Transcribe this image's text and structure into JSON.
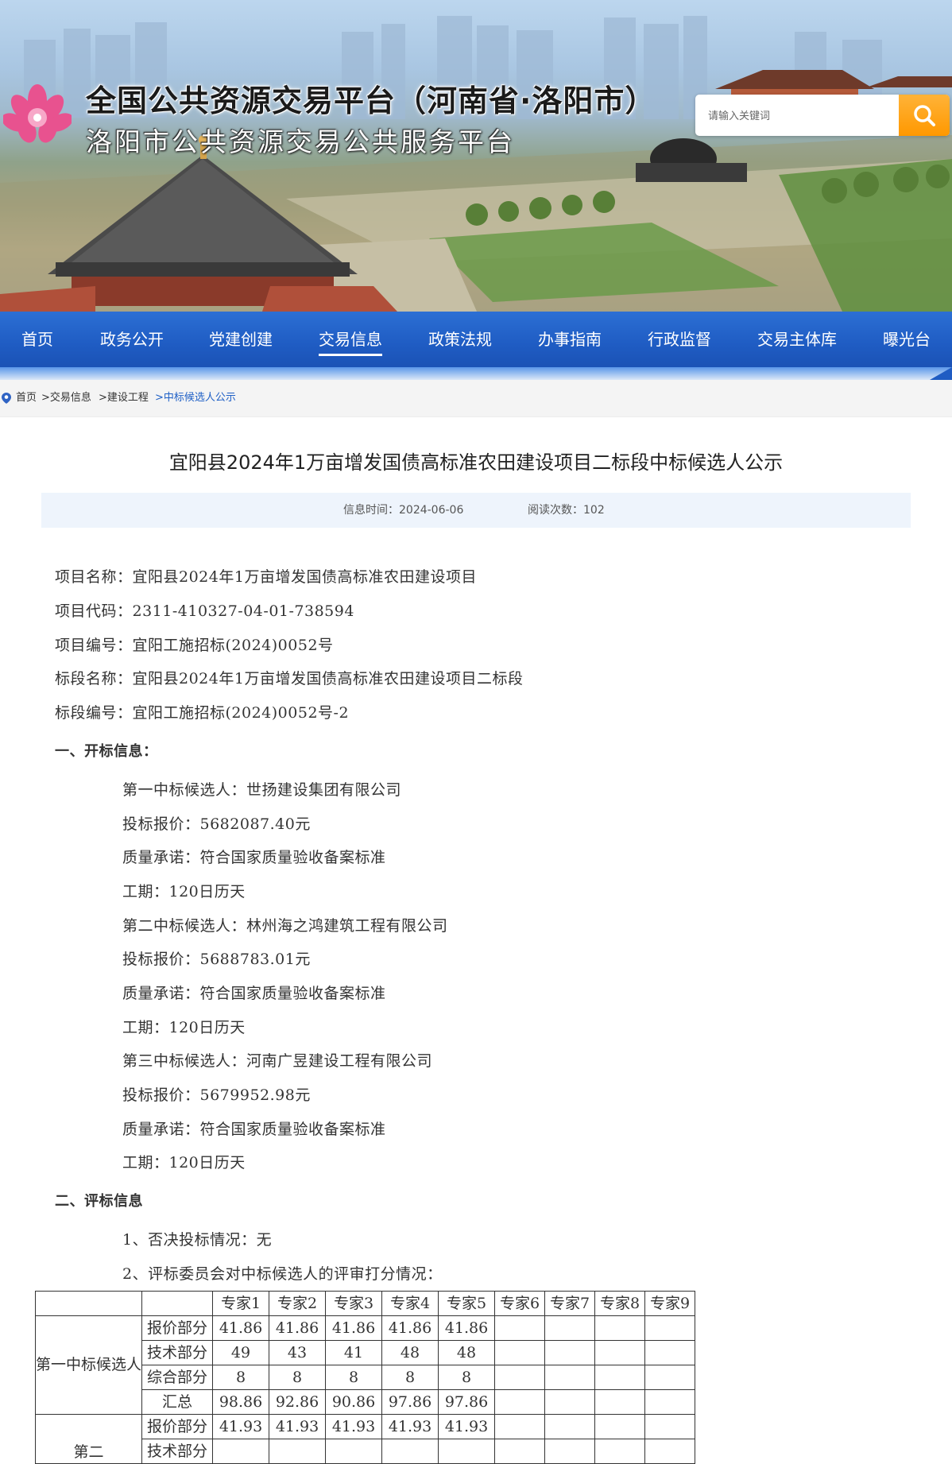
{
  "header": {
    "title": "全国公共资源交易平台（河南省·洛阳市）",
    "subtitle": "洛阳市公共资源交易公共服务平台",
    "search_placeholder": "请输入关键词"
  },
  "nav": {
    "items": [
      "首页",
      "政务公开",
      "党建创建",
      "交易信息",
      "政策法规",
      "办事指南",
      "行政监督",
      "交易主体库",
      "曝光台"
    ],
    "active": "交易信息"
  },
  "breadcrumb": {
    "items": [
      "首页",
      ">交易信息",
      ">建设工程",
      ">中标候选人公示"
    ]
  },
  "article": {
    "title": "宜阳县2024年1万亩增发国债高标准农田建设项目二标段中标候选人公示",
    "info_time": "信息时间：2024-06-06",
    "read_count": "阅读次数：102",
    "project_lines": [
      "项目名称：宜阳县2024年1万亩增发国债高标准农田建设项目",
      "项目代码：2311-410327-04-01-738594",
      "项目编号：宜阳工施招标(2024)0052号",
      "标段名称：宜阳县2024年1万亩增发国债高标准农田建设项目二标段",
      "标段编号：宜阳工施招标(2024)0052号-2"
    ],
    "section1": "一、开标信息：",
    "candidates": [
      "第一中标候选人：世扬建设集团有限公司",
      "投标报价：5682087.40元",
      "质量承诺：符合国家质量验收备案标准",
      "工期：120日历天",
      "第二中标候选人：林州海之鸿建筑工程有限公司",
      "投标报价：5688783.01元",
      "质量承诺：符合国家质量验收备案标准",
      "工期：120日历天",
      "第三中标候选人：河南广昱建设工程有限公司",
      "投标报价：5679952.98元",
      "质量承诺：符合国家质量验收备案标准",
      "工期：120日历天"
    ],
    "section2": "二、评标信息",
    "eval_lines": [
      "1、否决投标情况：无",
      "2、评标委员会对中标候选人的评审打分情况："
    ]
  },
  "score_table": {
    "headers": [
      "专家1",
      "专家2",
      "专家3",
      "专家4",
      "专家5",
      "专家6",
      "专家7",
      "专家8",
      "专家9"
    ],
    "group1_label": "第一中标候选人",
    "group1_rows": [
      [
        "报价部分",
        "41.86",
        "41.86",
        "41.86",
        "41.86",
        "41.86",
        "",
        "",
        "",
        ""
      ],
      [
        "技术部分",
        "49",
        "43",
        "41",
        "48",
        "48",
        "",
        "",
        "",
        ""
      ],
      [
        "综合部分",
        "8",
        "8",
        "8",
        "8",
        "8",
        "",
        "",
        "",
        ""
      ],
      [
        "汇总",
        "98.86",
        "92.86",
        "90.86",
        "97.86",
        "97.86",
        "",
        "",
        "",
        ""
      ]
    ],
    "group2_label": "第二",
    "group2_rows": [
      [
        "报价部分",
        "41.93",
        "41.93",
        "41.93",
        "41.93",
        "41.93",
        "",
        "",
        "",
        ""
      ],
      [
        "技术部分",
        "",
        "",
        "",
        "",
        "",
        "",
        "",
        "",
        ""
      ]
    ]
  },
  "colors": {
    "nav_blue": "#1f5cc3",
    "search_orange": "#ff9800",
    "breadcrumb_current": "#1e5fc6",
    "meta_bg": "#eef4fc"
  }
}
